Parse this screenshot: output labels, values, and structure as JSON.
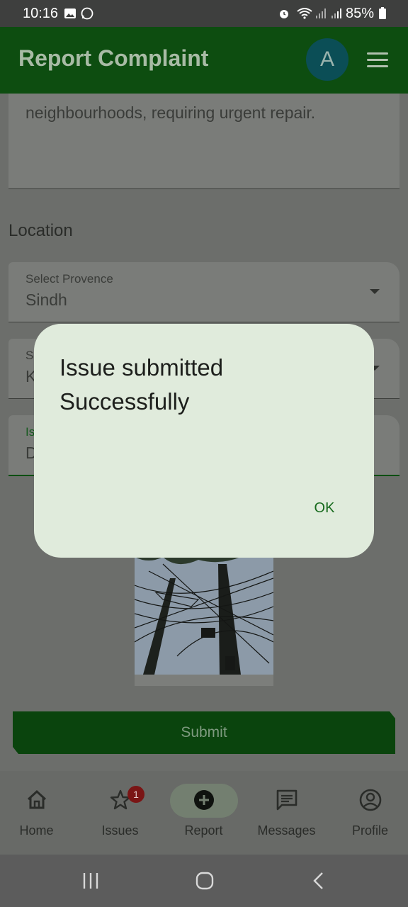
{
  "status_bar": {
    "time": "10:16",
    "battery": "85%",
    "icons": [
      "gallery-icon",
      "whatsapp-icon",
      "alarm-icon",
      "wifi-icon",
      "signal-icon",
      "signal-icon",
      "battery-icon"
    ]
  },
  "app_bar": {
    "title": "Report Complaint",
    "avatar_letter": "A"
  },
  "form": {
    "description_text": "neighbourhoods, requiring urgent repair.",
    "location_heading": "Location",
    "province_label": "Select Provence",
    "province_value": "Sindh",
    "city_label": "S",
    "city_value": "K",
    "issue_label": "Is",
    "issue_value": "D",
    "submit_label": "Submit"
  },
  "dialog": {
    "message": "Issue submitted Successfully",
    "ok_label": "OK"
  },
  "bottom_nav": {
    "items": [
      {
        "label": "Home",
        "icon": "home-icon"
      },
      {
        "label": "Issues",
        "icon": "star-icon",
        "badge": "1"
      },
      {
        "label": "Report",
        "icon": "add-circle-icon"
      },
      {
        "label": "Messages",
        "icon": "message-icon"
      },
      {
        "label": "Profile",
        "icon": "profile-icon"
      }
    ]
  },
  "colors": {
    "app_bar": "#0d4d10",
    "dialog_bg": "#e0ebdc",
    "accent": "#176a1d",
    "badge": "#b91c1c"
  }
}
